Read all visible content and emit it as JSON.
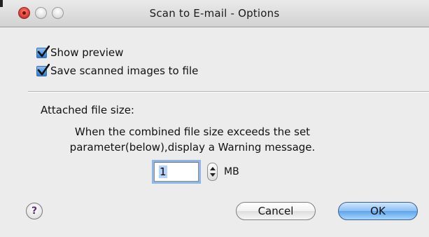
{
  "window": {
    "title": "Scan to E-mail - Options"
  },
  "options": {
    "show_preview": {
      "label": "Show preview",
      "checked": true
    },
    "save_scanned": {
      "label": "Save scanned images to file",
      "checked": true
    }
  },
  "attached_size": {
    "label": "Attached file size:",
    "description_line1": "When the combined file size exceeds the set",
    "description_line2": "parameter(below),display a Warning message.",
    "value": "1",
    "unit": "MB"
  },
  "buttons": {
    "help": "?",
    "cancel": "Cancel",
    "ok": "OK"
  },
  "icons": {
    "close": "close-icon",
    "minimize": "minimize-icon",
    "zoom": "zoom-icon",
    "checkmark": "checkmark-icon",
    "help": "help-icon",
    "stepper_up": "arrow-up-icon",
    "stepper_down": "arrow-down-icon"
  },
  "colors": {
    "close_button": "#e0443a",
    "default_button": "#5ea4ea",
    "focus_ring": "#8fb6e8",
    "checkbox_fill": "#2d7bd6"
  }
}
